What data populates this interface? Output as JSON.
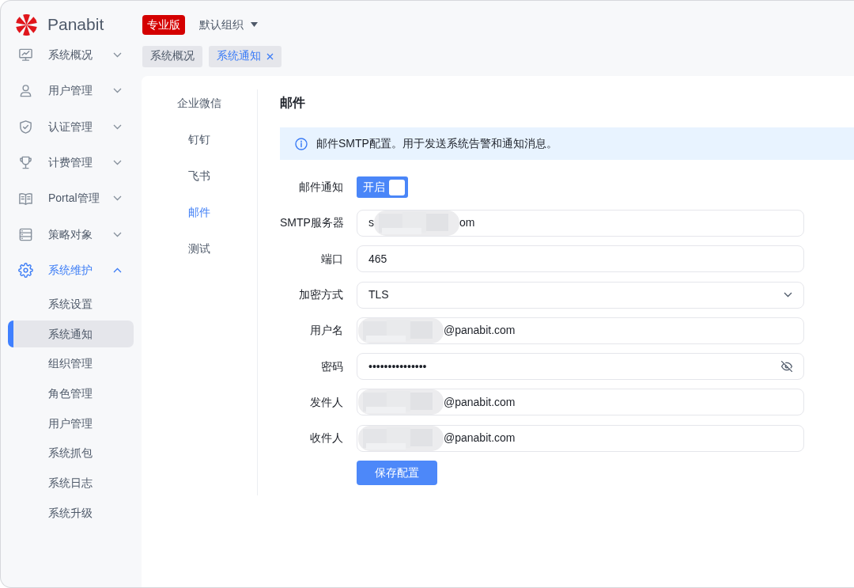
{
  "brand": {
    "name": "Panabit",
    "edition": "专业版"
  },
  "org_selector": {
    "label": "默认组织"
  },
  "sidebar": {
    "items": [
      {
        "label": "系统概况",
        "selected": false,
        "expanded": false
      },
      {
        "label": "用户管理",
        "selected": false,
        "expanded": false
      },
      {
        "label": "认证管理",
        "selected": false,
        "expanded": false
      },
      {
        "label": "计费管理",
        "selected": false,
        "expanded": false
      },
      {
        "label": "Portal管理",
        "selected": false,
        "expanded": false
      },
      {
        "label": "策略对象",
        "selected": false,
        "expanded": false
      },
      {
        "label": "系统维护",
        "selected": true,
        "expanded": true,
        "children": [
          {
            "label": "系统设置",
            "selected": false
          },
          {
            "label": "系统通知",
            "selected": true
          },
          {
            "label": "组织管理",
            "selected": false
          },
          {
            "label": "角色管理",
            "selected": false
          },
          {
            "label": "用户管理",
            "selected": false
          },
          {
            "label": "系统抓包",
            "selected": false
          },
          {
            "label": "系统日志",
            "selected": false
          },
          {
            "label": "系统升级",
            "selected": false
          }
        ]
      }
    ]
  },
  "tabs": [
    {
      "label": "系统概况",
      "selected": false,
      "closable": false
    },
    {
      "label": "系统通知",
      "selected": true,
      "closable": true
    }
  ],
  "channels": [
    {
      "label": "企业微信",
      "selected": false
    },
    {
      "label": "钉钉",
      "selected": false
    },
    {
      "label": "飞书",
      "selected": false
    },
    {
      "label": "邮件",
      "selected": true
    },
    {
      "label": "测试",
      "selected": false
    }
  ],
  "section": {
    "title": "邮件",
    "alert": "邮件SMTP配置。用于发送系统告警和通知消息。",
    "fields": [
      {
        "kind": "toggle",
        "label": "邮件通知",
        "on": true,
        "state_text": "开启"
      },
      {
        "kind": "text",
        "label": "SMTP服务器",
        "value_head": "s",
        "redacted": true,
        "value": "om"
      },
      {
        "kind": "text",
        "label": "端口",
        "redacted": false,
        "value": "465"
      },
      {
        "kind": "select",
        "label": "加密方式",
        "value": "TLS"
      },
      {
        "kind": "text",
        "label": "用户名",
        "redacted": true,
        "value": "@panabit.com"
      },
      {
        "kind": "password",
        "label": "密码",
        "value": "•••••••••••••••",
        "revealed": false
      },
      {
        "kind": "text",
        "label": "发件人",
        "redacted": true,
        "value": "@panabit.com"
      },
      {
        "kind": "text",
        "label": "收件人",
        "redacted": true,
        "value": "@panabit.com"
      }
    ],
    "submit": "保存配置"
  }
}
